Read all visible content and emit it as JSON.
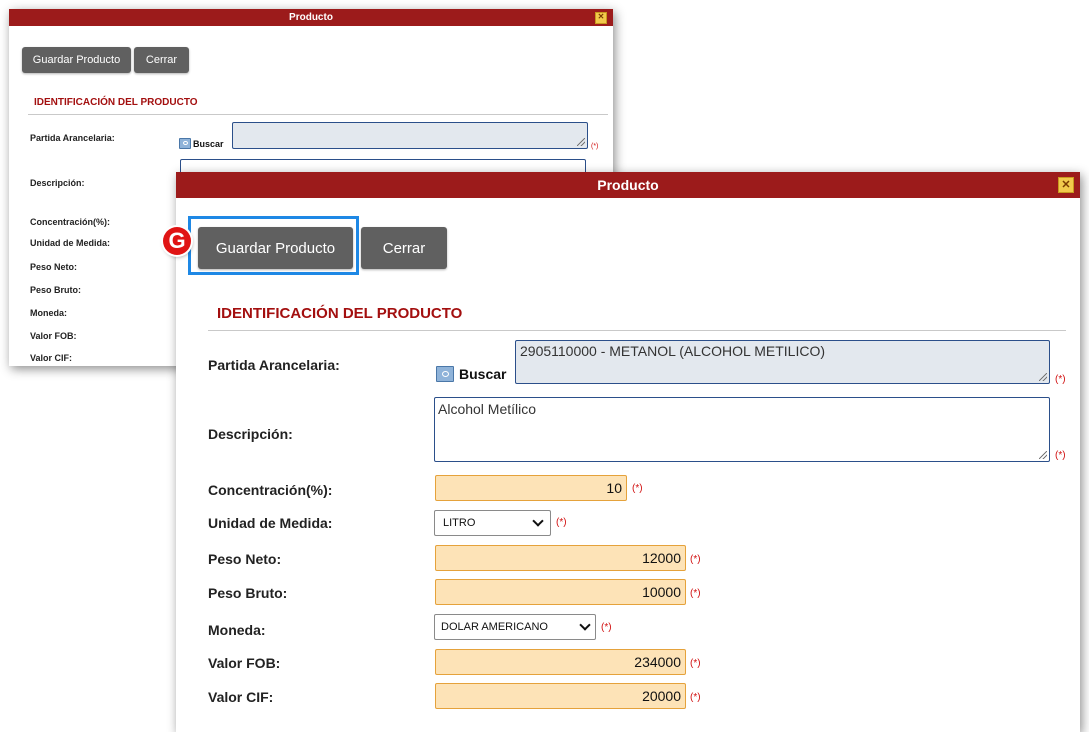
{
  "dialog_title": "Producto",
  "close_glyph": "✕",
  "buttons": {
    "save": "Guardar Producto",
    "close": "Cerrar"
  },
  "section_title": "IDENTIFICACIÓN DEL PRODUCTO",
  "buscar_label": "Buscar",
  "required_mark": "(*)",
  "step_badge": "G",
  "labels": {
    "partida": "Partida Arancelaria:",
    "descripcion": "Descripción:",
    "concentracion": "Concentración(%):",
    "unidad": "Unidad de Medida:",
    "peso_neto": "Peso Neto:",
    "peso_bruto": "Peso Bruto:",
    "moneda": "Moneda:",
    "valor_fob": "Valor FOB:",
    "valor_cif": "Valor CIF:"
  },
  "values": {
    "partida": "2905110000 - METANOL (ALCOHOL METILICO)",
    "descripcion": "Alcohol Metílico",
    "concentracion": "10",
    "unidad": "LITRO",
    "peso_neto": "12000",
    "peso_bruto": "10000",
    "moneda": "DOLAR AMERICANO",
    "valor_fob": "234000",
    "valor_cif": "20000"
  },
  "icons": {
    "buscar": "folder-search-icon",
    "close": "close-icon",
    "dropdown": "chevron-down-icon"
  },
  "colors": {
    "titlebar": "#9c1b1b",
    "section_title": "#a30f0f",
    "button": "#606060",
    "numeric_field": "#fde3b7",
    "highlight": "#1e88e5",
    "badge": "#e01414"
  }
}
